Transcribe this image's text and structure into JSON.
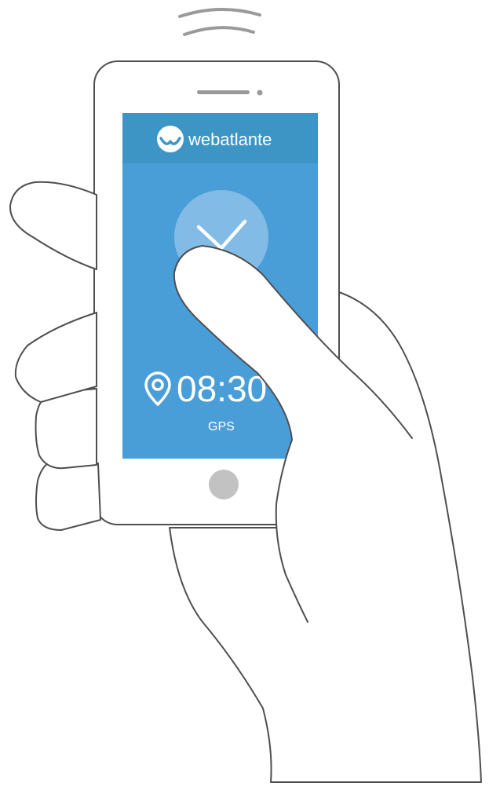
{
  "app": {
    "brand_name": "webatlante",
    "time": "08:30",
    "time_label": "GPS"
  },
  "icons": {
    "signal": "signal-waves-icon",
    "logo": "webatlante-logo-icon",
    "check": "check-icon",
    "location": "location-pin-icon",
    "home": "home-button-icon"
  },
  "colors": {
    "header_blue": "#3d95c6",
    "screen_blue": "#4a9ed8",
    "check_circle": "#82bbe6",
    "outline": "#4f4f4f",
    "signal_gray": "#9a9a9a",
    "home_button": "#c2c2c2",
    "white": "#ffffff"
  }
}
